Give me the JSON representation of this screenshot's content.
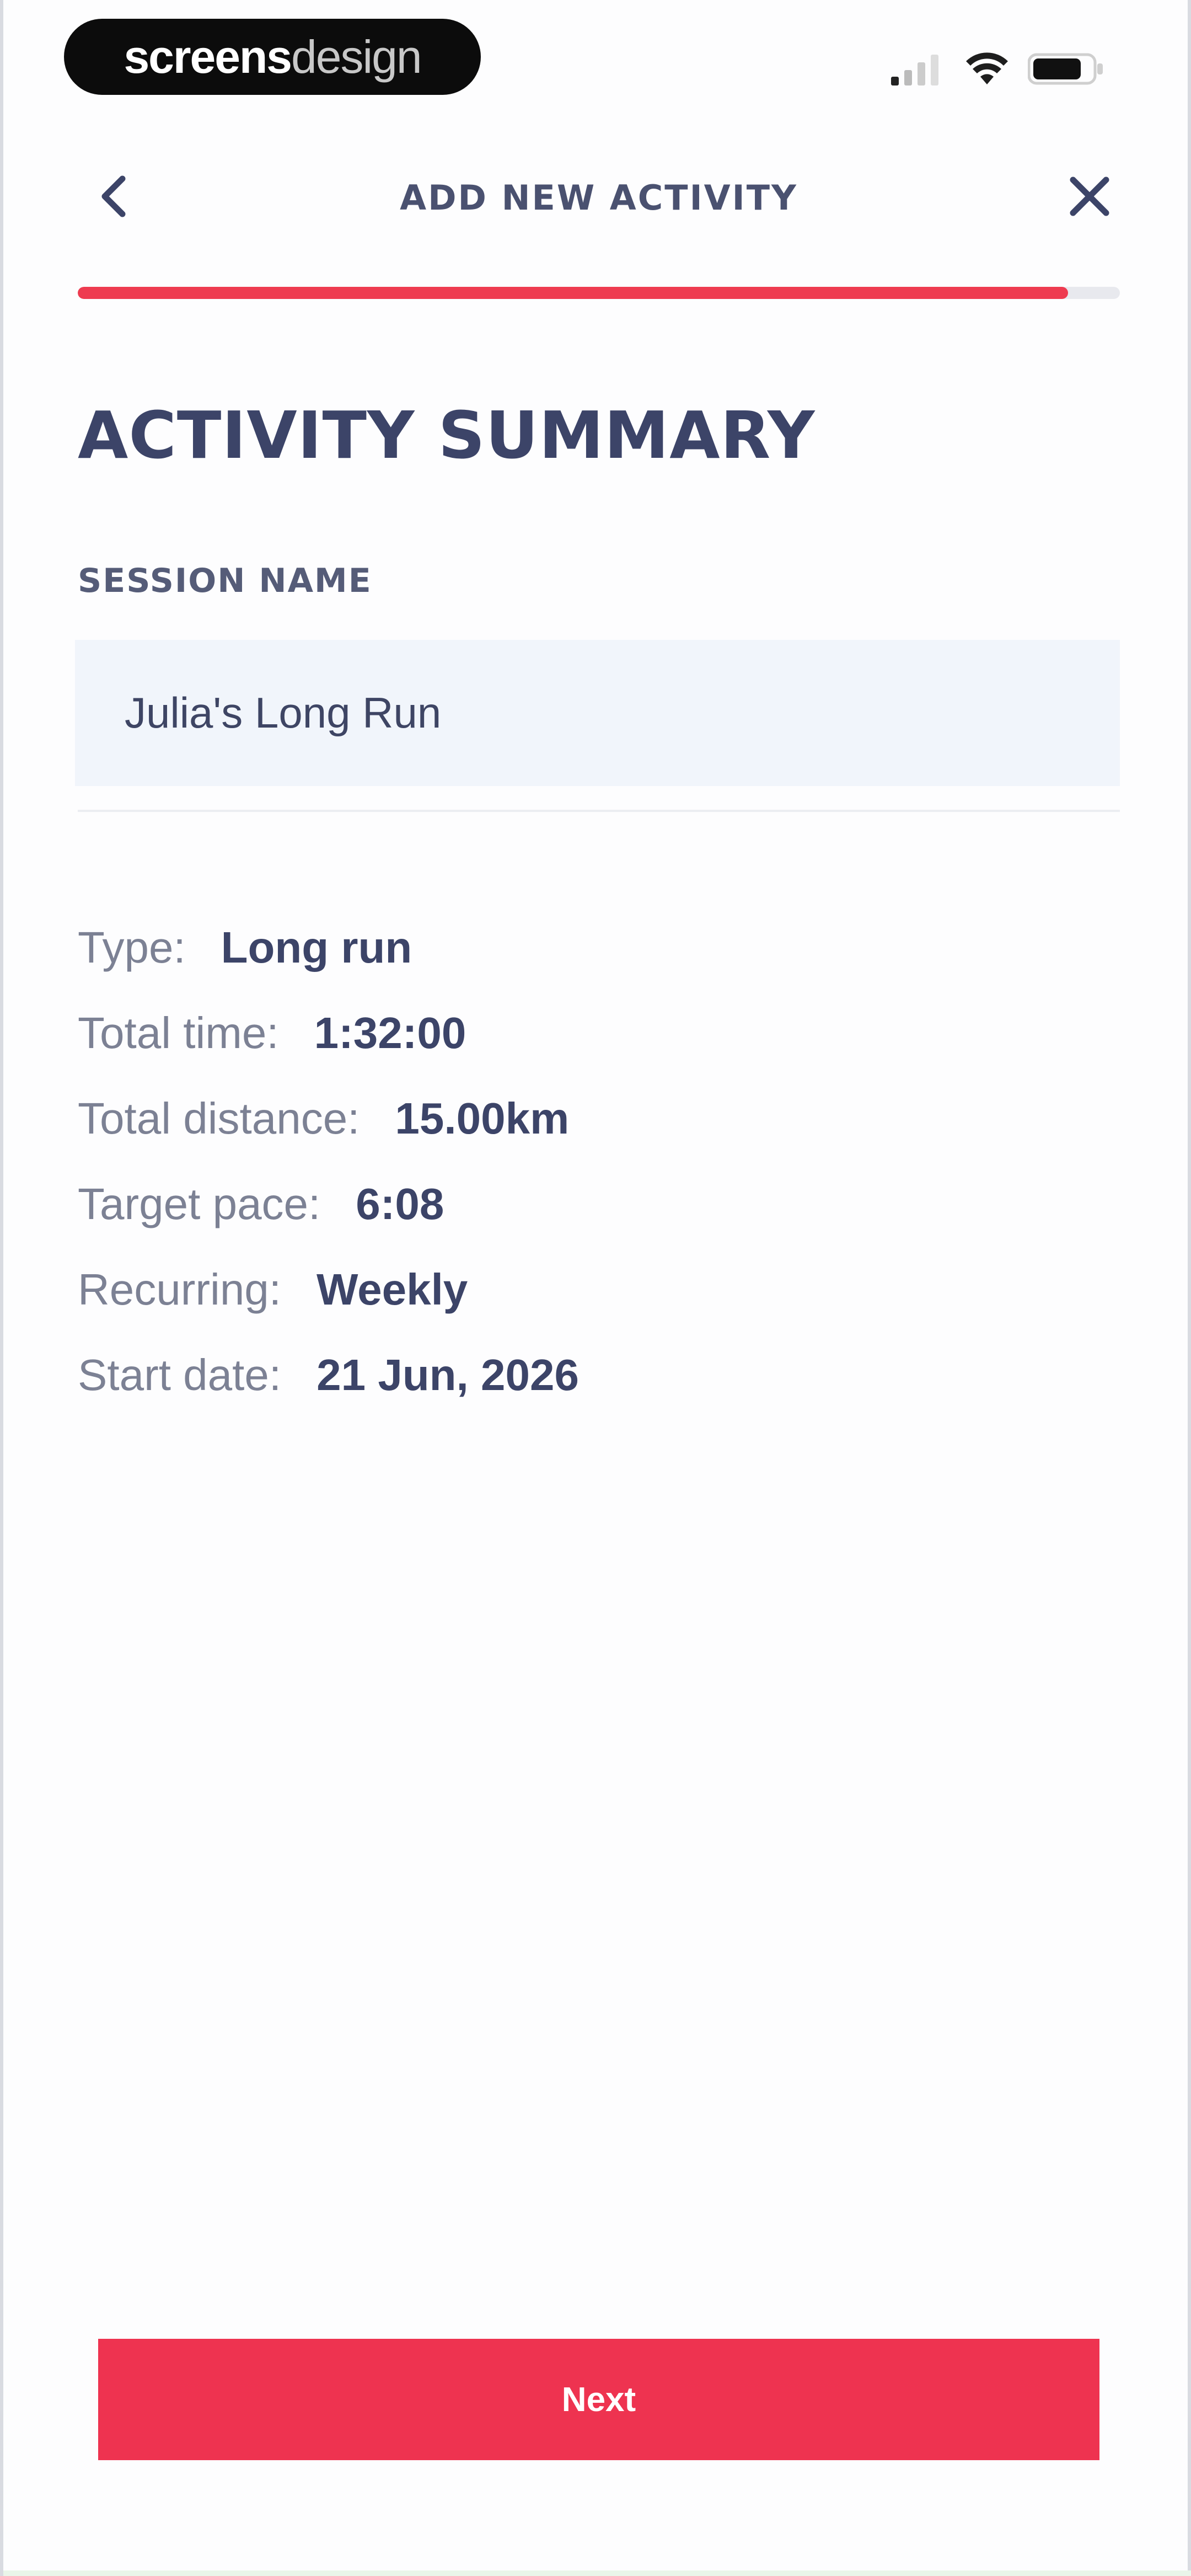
{
  "watermark": {
    "bold": "screens",
    "light": "design"
  },
  "status_bar": {
    "icons": [
      "signal-icon",
      "wifi-icon",
      "battery-icon"
    ]
  },
  "header": {
    "title": "ADD NEW ACTIVITY",
    "back_icon": "chevron-left-icon",
    "close_icon": "close-icon"
  },
  "progress": {
    "value_percent": 95
  },
  "summary_section": {
    "title": "ACTIVITY SUMMARY",
    "session_label": "SESSION NAME",
    "session_value": "Julia's Long Run",
    "rows": [
      {
        "label": "Type:",
        "value": "Long run"
      },
      {
        "label": "Total time:",
        "value": "1:32:00"
      },
      {
        "label": "Total distance:",
        "value": "15.00km"
      },
      {
        "label": "Target pace:",
        "value": "6:08"
      },
      {
        "label": "Recurring:",
        "value": "Weekly"
      },
      {
        "label": "Start date:",
        "value": "21 Jun, 2026"
      }
    ]
  },
  "actions": {
    "next_label": "Next"
  },
  "colors": {
    "accent": "#ee3350",
    "text_dark": "#3c4468",
    "text_muted": "#7c8194",
    "input_bg": "#f1f5fb"
  }
}
